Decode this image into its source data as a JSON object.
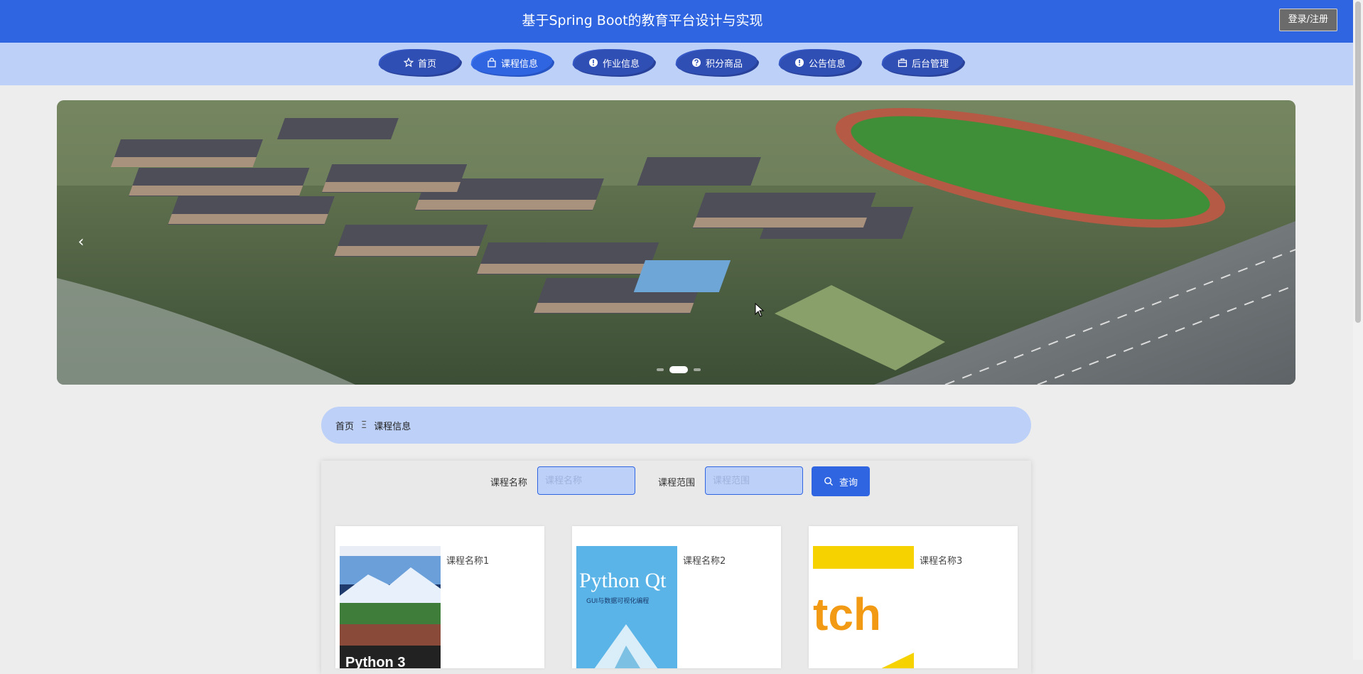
{
  "header": {
    "title": "基于Spring Boot的教育平台设计与实现",
    "login_label": "登录/注册"
  },
  "nav": {
    "items": [
      {
        "label": "首页",
        "icon": "star-icon"
      },
      {
        "label": "课程信息",
        "icon": "bag-icon"
      },
      {
        "label": "作业信息",
        "icon": "info-icon"
      },
      {
        "label": "积分商品",
        "icon": "question-icon"
      },
      {
        "label": "公告信息",
        "icon": "info-icon"
      },
      {
        "label": "后台管理",
        "icon": "box-icon"
      }
    ],
    "active_index": 1
  },
  "carousel": {
    "prev_arrow": "‹",
    "slide_count": 3,
    "active_slide": 1
  },
  "breadcrumb": {
    "home": "首页",
    "separator": "Ξ",
    "current": "课程信息"
  },
  "search": {
    "course_name_label": "课程名称",
    "course_name_placeholder": "课程名称",
    "course_range_label": "课程范围",
    "course_range_placeholder": "课程范围",
    "search_button": "查询"
  },
  "courses": [
    {
      "name": "课程名称1",
      "cover_text": "Python 3"
    },
    {
      "name": "课程名称2",
      "cover_text": "Python Qt",
      "cover_subtext": "GUI与数据可视化编程"
    },
    {
      "name": "课程名称3",
      "cover_text": "tch"
    }
  ],
  "colors": {
    "primary": "#2f65e1",
    "light": "#bcd0f8",
    "background": "#ededed"
  }
}
